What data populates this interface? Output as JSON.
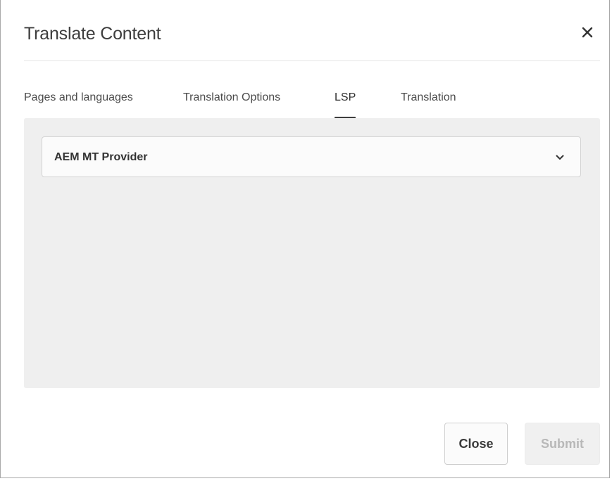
{
  "dialog": {
    "title": "Translate Content",
    "close_icon": "close-icon"
  },
  "tabs": [
    {
      "label": "Pages and languages",
      "active": false
    },
    {
      "label": "Translation Options",
      "active": false
    },
    {
      "label": "LSP",
      "active": true
    },
    {
      "label": "Translation",
      "active": false
    }
  ],
  "lsp": {
    "provider_selected": "AEM MT Provider",
    "dropdown_icon": "chevron-down-icon"
  },
  "footer": {
    "close_label": "Close",
    "submit_label": "Submit",
    "submit_enabled": false
  },
  "colors": {
    "panel_bg": "#efefef",
    "active_tab_underline": "#3e3e3e",
    "disabled_text": "#b8b8b8"
  }
}
